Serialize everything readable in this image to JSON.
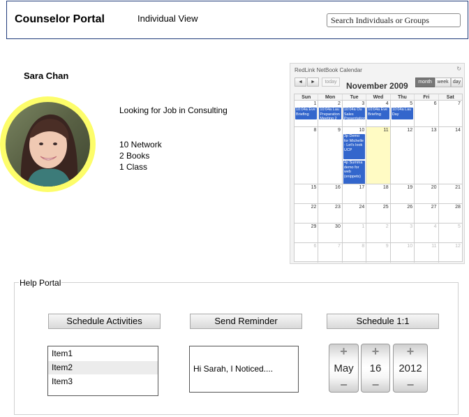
{
  "header": {
    "brand": "Counselor Portal",
    "view_title": "Individual View",
    "search_placeholder": "Search Individuals or Groups"
  },
  "profile": {
    "name": "Sara Chan",
    "status": "Looking for Job in Consulting",
    "stats": [
      "10 Network",
      "2 Books",
      "1 Class"
    ]
  },
  "calendar": {
    "title": "RedLink NetBook Calendar",
    "month_label": "November 2009",
    "today_label": "today",
    "prev": "◄",
    "next": "►",
    "refresh": "↻",
    "views": [
      "month",
      "week",
      "day"
    ],
    "active_view": "month",
    "weekdays": [
      "Sun",
      "Mon",
      "Tue",
      "Wed",
      "Thu",
      "Fri",
      "Sat"
    ],
    "today_date": "11",
    "weeks": [
      [
        {
          "d": "1"
        },
        {
          "d": "2"
        },
        {
          "d": "3"
        },
        {
          "d": "4"
        },
        {
          "d": "5"
        },
        {
          "d": "6"
        },
        {
          "d": "7"
        }
      ],
      [
        {
          "d": "8"
        },
        {
          "d": "9"
        },
        {
          "d": "10"
        },
        {
          "d": "11"
        },
        {
          "d": "12"
        },
        {
          "d": "13"
        },
        {
          "d": "14"
        }
      ],
      [
        {
          "d": "15"
        },
        {
          "d": "16"
        },
        {
          "d": "17"
        },
        {
          "d": "18"
        },
        {
          "d": "19"
        },
        {
          "d": "20"
        },
        {
          "d": "21"
        }
      ],
      [
        {
          "d": "22"
        },
        {
          "d": "23"
        },
        {
          "d": "24"
        },
        {
          "d": "25"
        },
        {
          "d": "26"
        },
        {
          "d": "27"
        },
        {
          "d": "28"
        }
      ],
      [
        {
          "d": "29"
        },
        {
          "d": "30"
        },
        {
          "d": "1",
          "other": true
        },
        {
          "d": "2",
          "other": true
        },
        {
          "d": "3",
          "other": true
        },
        {
          "d": "4",
          "other": true
        },
        {
          "d": "5",
          "other": true
        }
      ],
      [
        {
          "d": "6",
          "other": true
        },
        {
          "d": "7",
          "other": true
        },
        {
          "d": "8",
          "other": true
        },
        {
          "d": "9",
          "other": true
        },
        {
          "d": "10",
          "other": true
        },
        {
          "d": "11",
          "other": true
        },
        {
          "d": "12",
          "other": true
        }
      ]
    ],
    "events": [
      {
        "week": 0,
        "day": 0,
        "slot": 0,
        "text": "10:04a Eve Briefing"
      },
      {
        "week": 0,
        "day": 1,
        "slot": 0,
        "text": "10:04a Lau Preparation Meeting 2"
      },
      {
        "week": 0,
        "day": 2,
        "slot": 0,
        "text": "10:04a Ou Sales Presentation"
      },
      {
        "week": 0,
        "day": 3,
        "slot": 0,
        "text": "10:04a Eve Briefing"
      },
      {
        "week": 0,
        "day": 4,
        "slot": 0,
        "text": "10:04a Lau Day"
      },
      {
        "week": 1,
        "day": 2,
        "slot": 0,
        "text": "3p Demo for Michelle - Let's look UCP"
      },
      {
        "week": 1,
        "day": 2,
        "slot": 1,
        "text": "4p Summa demo for web (snippets)"
      }
    ]
  },
  "help_portal": {
    "legend": "Help Portal",
    "buttons": [
      "Schedule Activities",
      "Send Reminder",
      "Schedule 1:1"
    ],
    "list_items": [
      "Item1",
      "Item2",
      "Item3"
    ],
    "selected_item": "Item2",
    "message": "Hi Sarah,  I Noticed....",
    "date_picker": {
      "month": "May",
      "day": "16",
      "year": "2012",
      "plus": "+",
      "minus": "−"
    }
  },
  "colors": {
    "header_border": "#1f3b7a",
    "avatar_ring": "#fdfd6a",
    "event_blue": "#3366cc",
    "today_highlight": "#fffbc4"
  }
}
